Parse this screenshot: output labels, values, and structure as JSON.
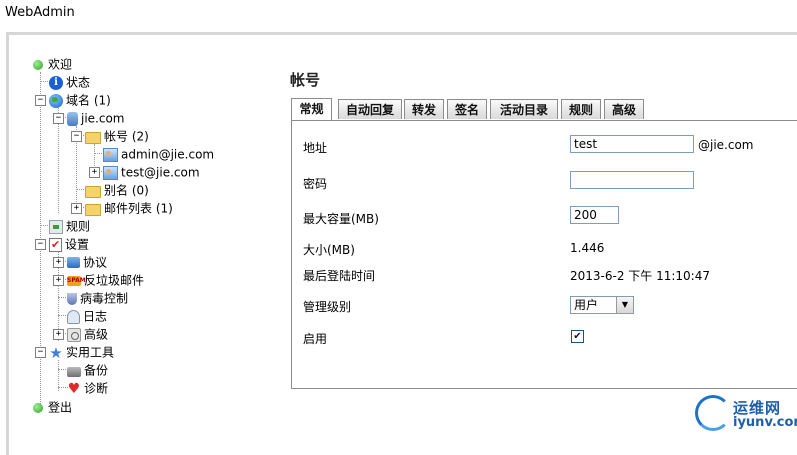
{
  "app": {
    "title": "WebAdmin"
  },
  "tree": {
    "welcome": "欢迎",
    "status": "状态",
    "domains": "域名 (1)",
    "domain": "jie.com",
    "accounts": "帐号 (2)",
    "account1": "admin@jie.com",
    "account2": "test@jie.com",
    "aliases": "别名 (0)",
    "mailing_lists": "邮件列表 (1)",
    "rules": "规则",
    "settings": "设置",
    "protocols": "协议",
    "antispam": "反垃圾邮件",
    "antivirus": "病毒控制",
    "logging": "日志",
    "advanced": "高级",
    "utilities": "实用工具",
    "backup": "备份",
    "diagnostics": "诊断",
    "logout": "登出"
  },
  "content": {
    "title": "帐号",
    "tabs": [
      "常规",
      "自动回复",
      "转发",
      "签名",
      "活动目录",
      "规则",
      "高级"
    ],
    "form": {
      "address_label": "地址",
      "address_value": "test",
      "domain_suffix": "@jie.com",
      "password_label": "密码",
      "password_value": "",
      "max_size_label": "最大容量(MB)",
      "max_size_value": "200",
      "size_label": "大小(MB)",
      "size_value": "1.446",
      "last_login_label": "最后登陆时间",
      "last_login_value": "2013-6-2 下午 11:10:47",
      "admin_level_label": "管理级别",
      "admin_level_value": "用户",
      "enabled_label": "启用",
      "enabled": true
    }
  },
  "watermark": {
    "cn": "运维网",
    "url": "iyunv.com"
  }
}
